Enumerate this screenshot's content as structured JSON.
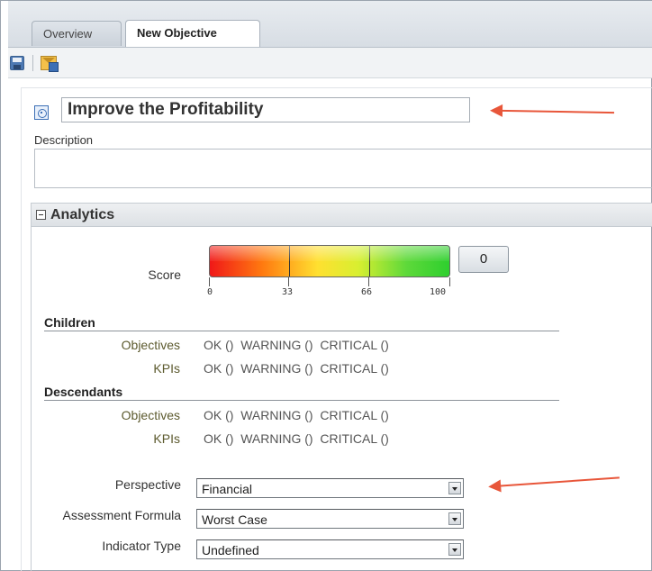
{
  "tabs": [
    {
      "label": "Overview",
      "active": false
    },
    {
      "label": "New Objective",
      "active": true
    }
  ],
  "toolbar": {
    "icons": [
      "save-icon",
      "email-icon"
    ]
  },
  "objective": {
    "name": "Improve the Profitability",
    "description_label": "Description",
    "description_value": ""
  },
  "analytics": {
    "title": "Analytics",
    "score_label": "Score",
    "score_value": "0",
    "gauge_ticks": [
      "0",
      "33",
      "66",
      "100"
    ],
    "gauge_colors": {
      "low": "#f01818",
      "mid": "#ffe030",
      "high": "#2ecf2e"
    },
    "children": {
      "title": "Children",
      "rows": [
        {
          "label": "Objectives",
          "status": "OK ()  WARNING ()  CRITICAL ()"
        },
        {
          "label": "KPIs",
          "status": "OK ()  WARNING ()  CRITICAL ()"
        }
      ]
    },
    "descendants": {
      "title": "Descendants",
      "rows": [
        {
          "label": "Objectives",
          "status": "OK ()  WARNING ()  CRITICAL ()"
        },
        {
          "label": "KPIs",
          "status": "OK ()  WARNING ()  CRITICAL ()"
        }
      ]
    },
    "fields": [
      {
        "label": "Perspective",
        "value": "Financial"
      },
      {
        "label": "Assessment Formula",
        "value": "Worst Case"
      },
      {
        "label": "Indicator Type",
        "value": "Undefined"
      }
    ]
  },
  "annotation_color": "#e8563a"
}
